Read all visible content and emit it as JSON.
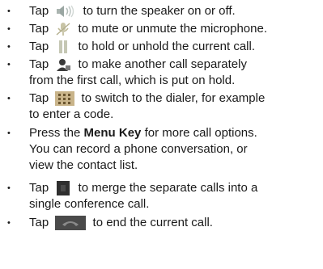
{
  "items": [
    {
      "pre": "Tap",
      "post": "to turn the speaker on or off.",
      "icon": "speaker-icon"
    },
    {
      "pre": "Tap",
      "post": "to mute or unmute the microphone.",
      "icon": "microphone-mute-icon"
    },
    {
      "pre": "Tap",
      "post": "to hold or unhold the current call.",
      "icon": "hold-icon"
    },
    {
      "pre": "Tap",
      "post": "to make another call separately",
      "post2": "from the first call, which is put on hold.",
      "icon": "add-call-icon"
    },
    {
      "pre": "Tap",
      "post": "to switch to the dialer, for example",
      "post2": "to enter a code.",
      "icon": "dialpad-icon"
    },
    {
      "pre": "Press the",
      "bold": "Menu Key",
      "post": "for more call options.",
      "post2": "You can record a phone conversation, or",
      "post3": "view the contact list."
    },
    {
      "pre": "Tap",
      "post": "to merge the separate calls into a",
      "post2": "single conference call.",
      "icon": "merge-calls-icon"
    },
    {
      "pre": "Tap",
      "post": "to end the current call.",
      "icon": "end-call-icon"
    }
  ],
  "bullet_char": "•"
}
